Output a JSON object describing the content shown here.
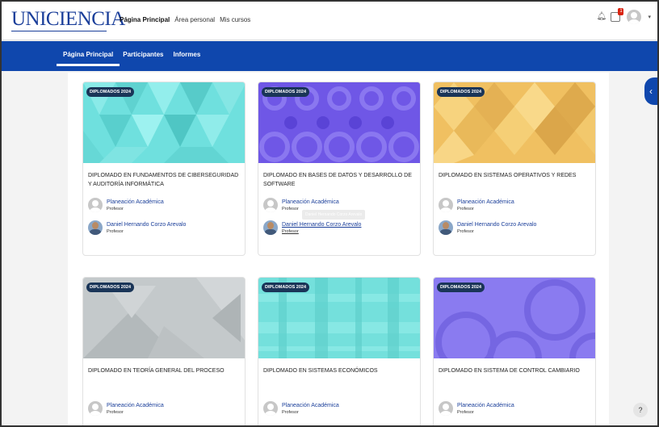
{
  "brand": {
    "logo_text": "UNICIENCIA"
  },
  "topnav": [
    {
      "label": "Página Principal",
      "active": true
    },
    {
      "label": "Área personal",
      "active": false
    },
    {
      "label": "Mis cursos",
      "active": false
    }
  ],
  "notifications": {
    "badge": "1"
  },
  "secondary_tabs": [
    {
      "label": "Página Principal",
      "active": true
    },
    {
      "label": "Participantes",
      "active": false
    },
    {
      "label": "Informes",
      "active": false
    }
  ],
  "courses": [
    {
      "category": "DIPLOMADOS 2024",
      "title": "DIPLOMADO EN FUNDAMENTOS DE CIBERSEGURIDAD Y AUDITORÍA INFORMÁTICA",
      "pattern": "teal-triangles",
      "teachers": [
        {
          "name": "Planeación Académica",
          "role": "Profesor",
          "avatar": "generic"
        },
        {
          "name": "Daniel Hernando Corzo Arevalo",
          "role": "Profesor",
          "avatar": "photo"
        }
      ]
    },
    {
      "category": "DIPLOMADOS 2024",
      "title": "DIPLOMADO EN BASES DE DATOS Y DESARROLLO DE SOFTWARE",
      "pattern": "purple-circles",
      "teachers": [
        {
          "name": "Planeación Académica",
          "role": "Profesor",
          "avatar": "generic"
        },
        {
          "name": "Daniel Hernando Corzo Arevalo",
          "role": "Profesor",
          "avatar": "photo"
        }
      ]
    },
    {
      "category": "DIPLOMADOS 2024",
      "title": "DIPLOMADO EN SISTEMAS OPERATIVOS Y REDES",
      "pattern": "gold-diamonds",
      "teachers": [
        {
          "name": "Planeación Académica",
          "role": "Profesor",
          "avatar": "generic"
        },
        {
          "name": "Daniel Hernando Corzo Arevalo",
          "role": "Profesor",
          "avatar": "photo"
        }
      ]
    },
    {
      "category": "DIPLOMADOS 2024",
      "title": "DIPLOMADO EN TEORÍA GENERAL DEL PROCESO",
      "pattern": "gray-triangles",
      "teachers": [
        {
          "name": "Planeación Académica",
          "role": "Profesor",
          "avatar": "generic"
        }
      ]
    },
    {
      "category": "DIPLOMADOS 2024",
      "title": "DIPLOMADO EN SISTEMAS ECONÓMICOS",
      "pattern": "teal-plaid",
      "teachers": [
        {
          "name": "Planeación Académica",
          "role": "Profesor",
          "avatar": "generic"
        }
      ]
    },
    {
      "category": "DIPLOMADOS 2024",
      "title": "DIPLOMADO EN SISTEMA DE CONTROL CAMBIARIO",
      "pattern": "violet-rings",
      "teachers": [
        {
          "name": "Planeación Académica",
          "role": "Profesor",
          "avatar": "generic"
        }
      ]
    }
  ],
  "tooltip": {
    "text": "Daniel Hernando Corzo Arevalo"
  },
  "help": {
    "label": "?"
  },
  "drawer_toggle": {
    "label": "‹"
  }
}
